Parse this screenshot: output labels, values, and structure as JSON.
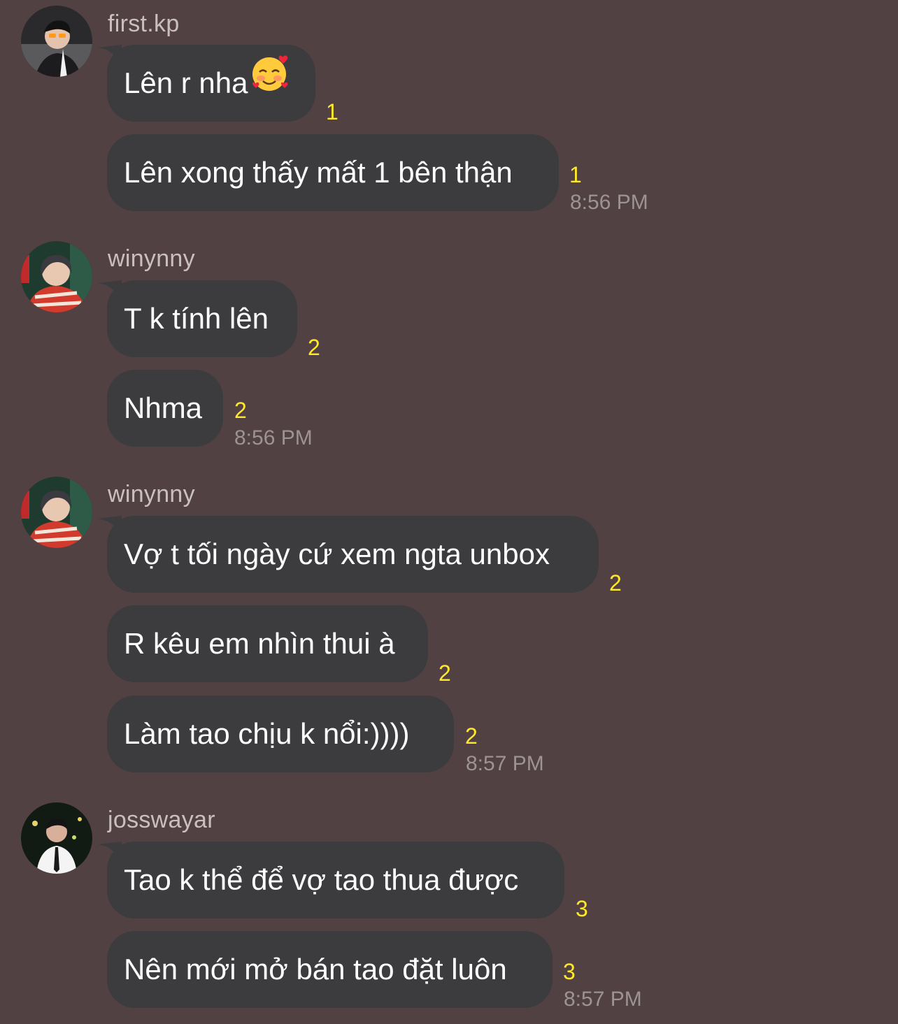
{
  "groups": [
    {
      "name": "first.kp",
      "messages": [
        {
          "text": "Lên r nha",
          "emoji": "smiling-face-with-hearts",
          "seen": "1"
        },
        {
          "text": "Lên xong thấy mất 1 bên thận",
          "seen": "1"
        }
      ],
      "time": "8:56 PM"
    },
    {
      "name": "winynny",
      "messages": [
        {
          "text": "T k tính lên",
          "seen": "2"
        },
        {
          "text": "Nhma",
          "seen": "2"
        }
      ],
      "time": "8:56 PM"
    },
    {
      "name": "winynny",
      "messages": [
        {
          "text": "Vợ t tối ngày cứ xem ngta unbox",
          "seen": "2"
        },
        {
          "text": "R kêu em nhìn thui à",
          "seen": "2"
        },
        {
          "text": "Làm tao chịu k nổi:))))",
          "seen": "2"
        }
      ],
      "time": "8:57 PM"
    },
    {
      "name": "josswayar",
      "messages": [
        {
          "text": "Tao k thể để vợ tao thua được",
          "seen": "3"
        },
        {
          "text": "Nên mới mở bán tao đặt luôn",
          "seen": "3"
        }
      ],
      "time": "8:57 PM"
    }
  ],
  "colors": {
    "background": "#524142",
    "bubble": "#3c3b3d",
    "seen_count": "#ffe82a",
    "username": "#c9bfbf",
    "timestamp": "#9c9393"
  }
}
